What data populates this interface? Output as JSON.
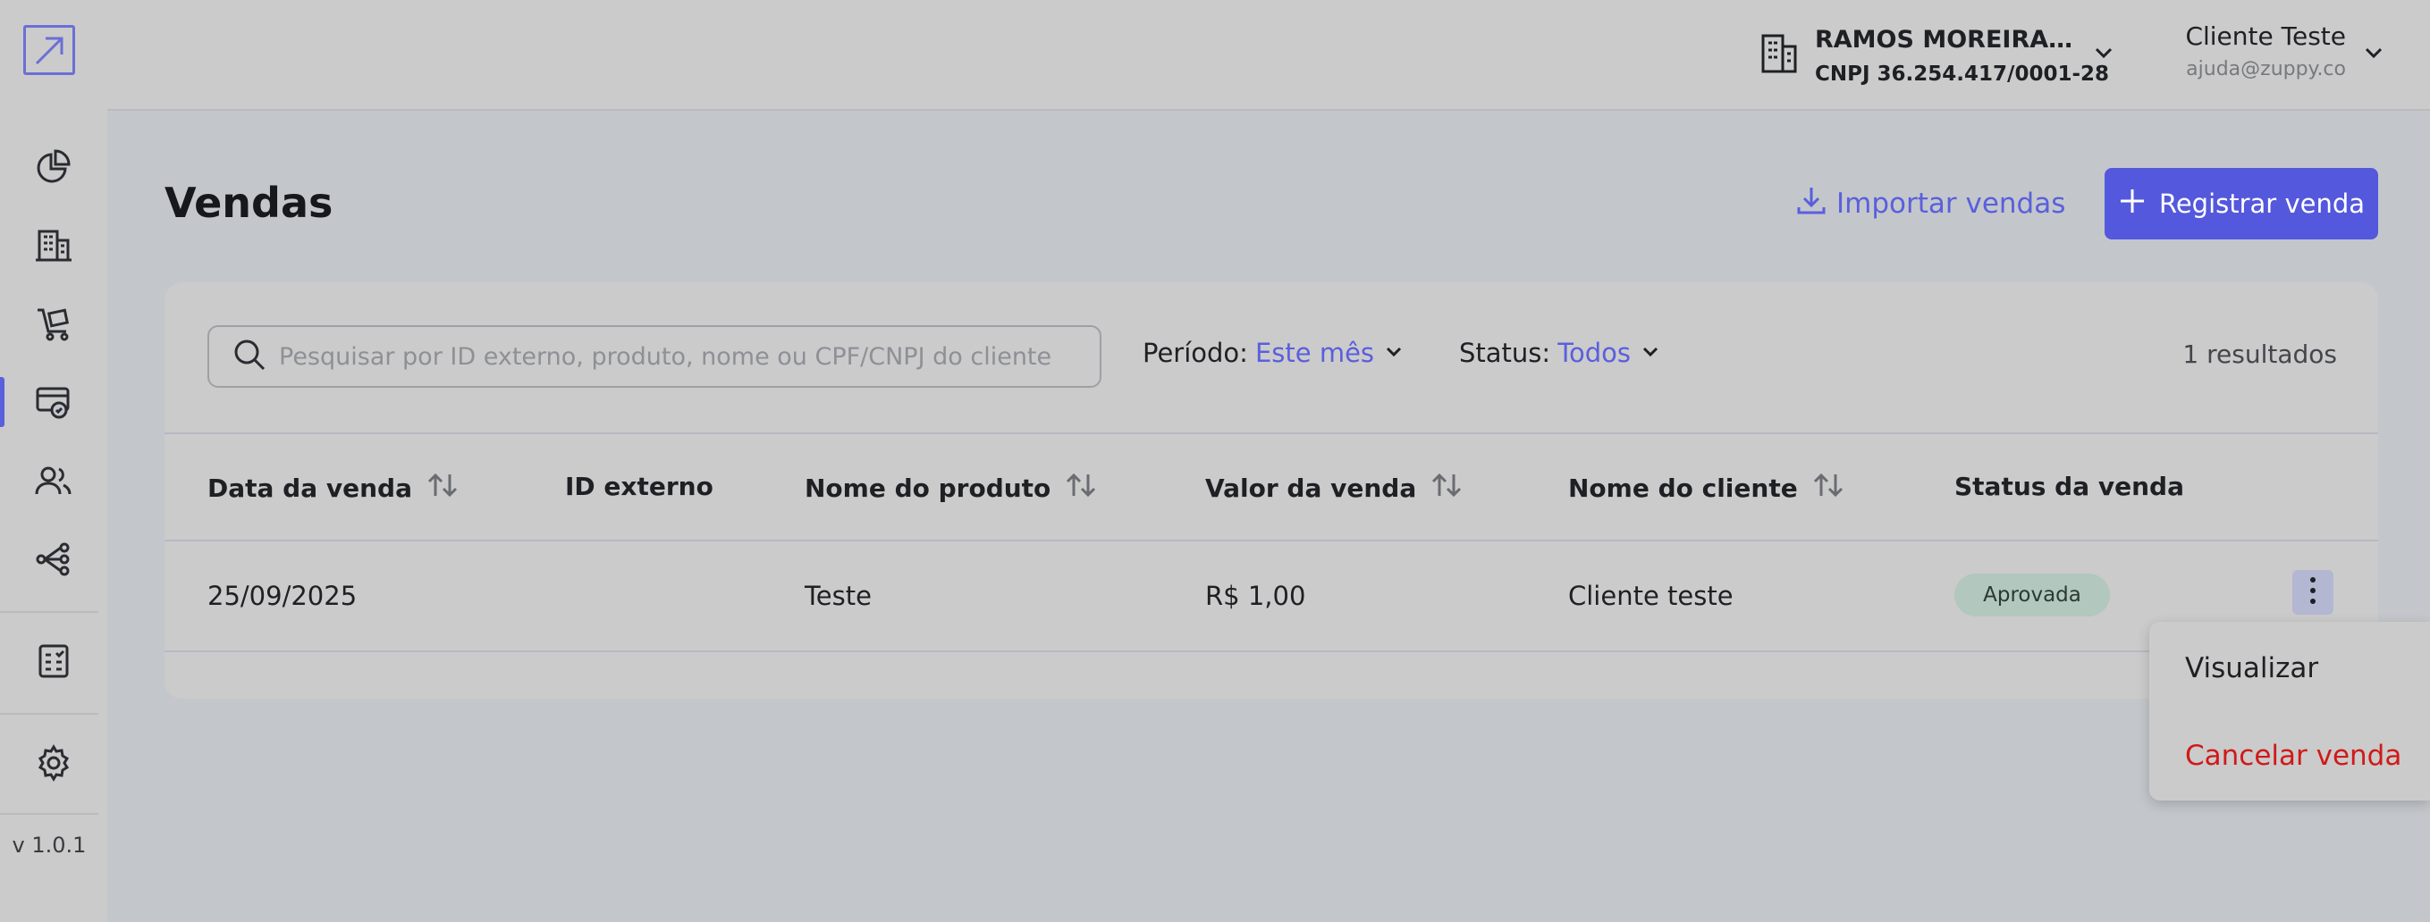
{
  "colors": {
    "accent": "#5458dc",
    "danger": "#d01919",
    "success_badge": "#b2c7bd"
  },
  "sidebar": {
    "logo": "logo-arrow-icon",
    "items": [
      {
        "icon": "pie-chart-icon",
        "active": false
      },
      {
        "icon": "building-icon",
        "active": false
      },
      {
        "icon": "cart-icon",
        "active": false
      },
      {
        "icon": "sales-icon",
        "active": true
      },
      {
        "icon": "users-icon",
        "active": false
      },
      {
        "icon": "network-icon",
        "active": false
      },
      {
        "icon": "report-icon",
        "active": false
      },
      {
        "icon": "gear-icon",
        "active": false
      }
    ],
    "version": "v 1.0.1"
  },
  "header": {
    "company_name": "RAMOS MOREIRA SO...",
    "company_cnpj": "CNPJ 36.254.417/0001-28",
    "user_name": "Cliente Teste",
    "user_email": "ajuda@zuppy.co"
  },
  "page": {
    "title": "Vendas",
    "import_label": "Importar vendas",
    "register_label": "Registrar venda"
  },
  "filters": {
    "search_placeholder": "Pesquisar por ID externo, produto, nome ou CPF/CNPJ do cliente",
    "period_label": "Período:",
    "period_value": "Este mês",
    "status_label": "Status:",
    "status_value": "Todos",
    "results": "1 resultados"
  },
  "table": {
    "headers": {
      "date": "Data da venda",
      "external_id": "ID externo",
      "product": "Nome do produto",
      "value": "Valor da venda",
      "client": "Nome do cliente",
      "status": "Status da venda"
    },
    "rows": [
      {
        "date": "25/09/2025",
        "external_id": "",
        "product": "Teste",
        "value": "R$ 1,00",
        "client": "Cliente teste",
        "status": "Aprovada"
      }
    ]
  },
  "row_menu": {
    "view": "Visualizar",
    "cancel": "Cancelar venda"
  }
}
